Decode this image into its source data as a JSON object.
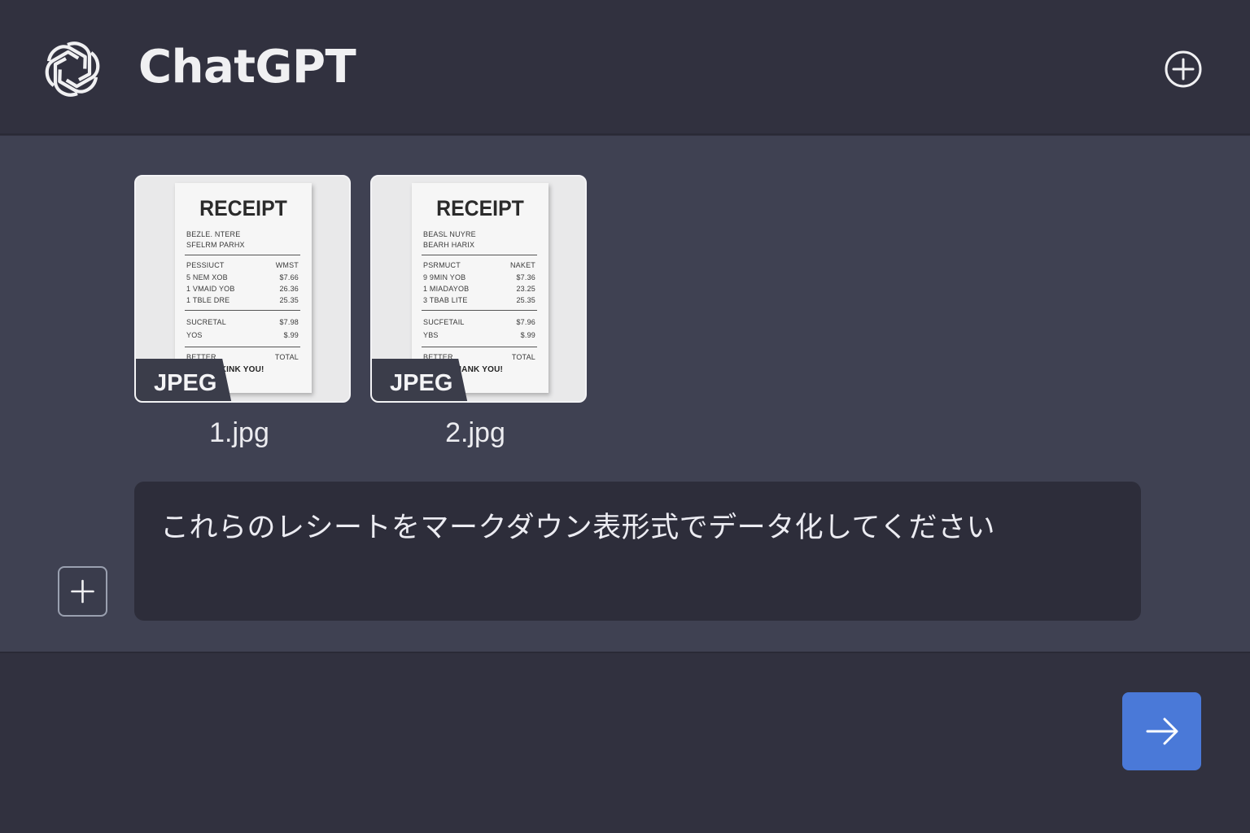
{
  "header": {
    "title": "ChatGPT",
    "logo_icon": "openai-logo-icon",
    "new_chat_icon": "plus-circle-icon"
  },
  "attachments": [
    {
      "filename": "1.jpg",
      "badge": "JPEG",
      "receipt": {
        "title": "RECEIPT",
        "header_lines": [
          "BEZLE. NTERE",
          "SFELRM PARHX"
        ],
        "col_left": "PESSIUCT",
        "col_right": "WMST",
        "items": [
          {
            "name": "5 NEM XOB",
            "price": "$7.66"
          },
          {
            "name": "1 VMAID YOB",
            "price": "26.36"
          },
          {
            "name": "1 TBLE DRE",
            "price": "25.35"
          }
        ],
        "subtotal_label": "SUCRETAL",
        "subtotal_value": "$7.98",
        "tax_label": "YOS",
        "tax_value": "$.99",
        "footer_left": "BETTER",
        "footer_right": "TOTAL",
        "thanks": "THKINK YOU!"
      }
    },
    {
      "filename": "2.jpg",
      "badge": "JPEG",
      "receipt": {
        "title": "RECEIPT",
        "header_lines": [
          "BEASL NUYRE",
          "BEARH HARIX"
        ],
        "col_left": "PSRMUCT",
        "col_right": "NAKET",
        "items": [
          {
            "name": "9 9MIN YOB",
            "price": "$7.36"
          },
          {
            "name": "1 MIADAYOB",
            "price": "23.25"
          },
          {
            "name": "3 TBAB LITE",
            "price": "25.35"
          }
        ],
        "subtotal_label": "SUCFETAIL",
        "subtotal_value": "$7.96",
        "tax_label": "YBS",
        "tax_value": "$.99",
        "footer_left": "BETTER",
        "footer_right": "TOTAL",
        "thanks": "THHANK YOU!"
      }
    }
  ],
  "prompt": {
    "text": "これらのレシートをマークダウン表形式でデータ化してください"
  },
  "actions": {
    "attach_icon": "plus-icon",
    "send_icon": "arrow-right-icon",
    "send_color": "#4a79d8"
  }
}
